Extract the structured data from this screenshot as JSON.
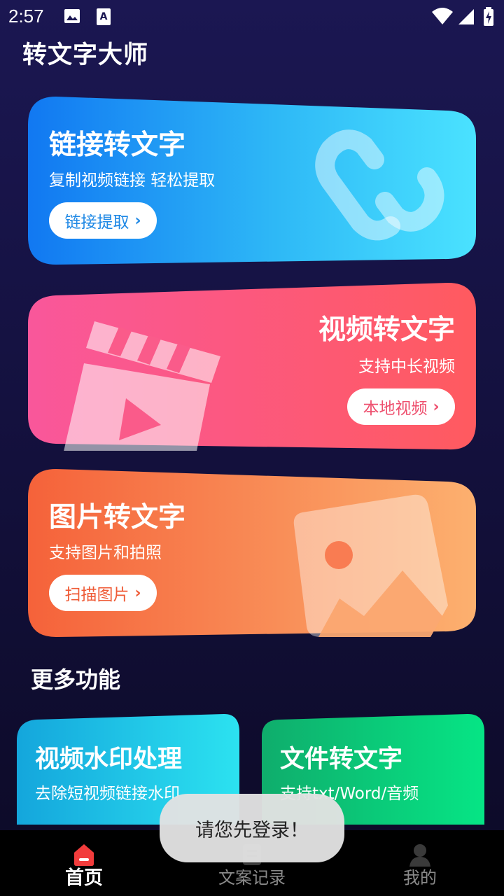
{
  "status_bar": {
    "time": "2:57"
  },
  "app": {
    "title": "转文字大师"
  },
  "cards": {
    "link": {
      "title": "链接转文字",
      "subtitle": "复制视频链接 轻松提取",
      "button": "链接提取",
      "accent": "#1e88e5"
    },
    "video": {
      "title": "视频转文字",
      "subtitle": "支持中长视频",
      "button": "本地视频",
      "accent": "#ee4f6e"
    },
    "image": {
      "title": "图片转文字",
      "subtitle": "支持图片和拍照",
      "button": "扫描图片",
      "accent": "#ef5a35"
    }
  },
  "more": {
    "title": "更多功能",
    "watermark": {
      "title": "视频水印处理",
      "subtitle": "去除短视频链接水印"
    },
    "file": {
      "title": "文件转文字",
      "subtitle": "支持txt/Word/音频"
    }
  },
  "bottom_nav": {
    "items": [
      {
        "label": "首页",
        "icon": "home-icon",
        "active": true
      },
      {
        "label": "文案记录",
        "icon": "document-icon",
        "active": false
      },
      {
        "label": "我的",
        "icon": "person-icon",
        "active": false
      }
    ]
  },
  "toast": {
    "text": "请您先登录！"
  },
  "chevron": "›"
}
